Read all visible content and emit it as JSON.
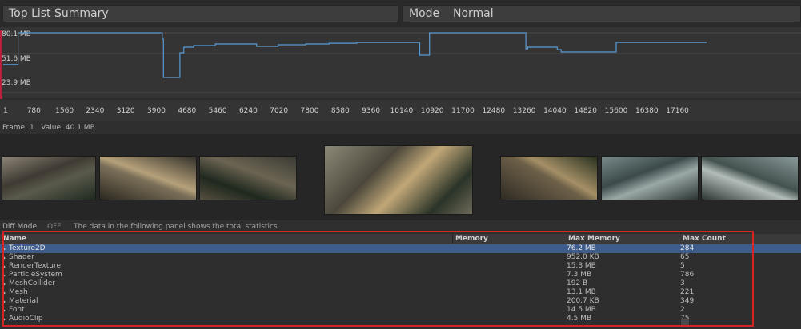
{
  "header": {
    "title": "Top List  Summary",
    "mode_label": "Mode",
    "mode_value": "Normal"
  },
  "chart_data": {
    "type": "line",
    "y_labels": [
      "80.1 MB",
      "51.6 MB",
      "23.9 MB"
    ],
    "x_ticks": [
      "1",
      "780",
      "1560",
      "2340",
      "3120",
      "3900",
      "4680",
      "5460",
      "6240",
      "7020",
      "7800",
      "8580",
      "9360",
      "10140",
      "10920",
      "11700",
      "12480",
      "13260",
      "14040",
      "14820",
      "15600",
      "16380",
      "17160"
    ],
    "series": [
      {
        "x": [
          1,
          380,
          4000,
          4050,
          4080,
          4420,
          4500,
          4600,
          4850,
          5400,
          6300,
          6450,
          7000,
          7700,
          8300,
          9000,
          9800,
          10500,
          10600,
          10700,
          10780,
          10850,
          11500,
          13200,
          13300,
          13350,
          14100,
          14200,
          15500,
          15600,
          17900
        ],
        "y": [
          40.1,
          80.1,
          80.1,
          72,
          23.9,
          23.9,
          55,
          62,
          64,
          66,
          66,
          63,
          65,
          66,
          67,
          68,
          68,
          68,
          52,
          52,
          52,
          80.1,
          80.1,
          80.1,
          60,
          62,
          59,
          56,
          56,
          68,
          68
        ]
      }
    ],
    "color": "#5a9bd5"
  },
  "frame_info": {
    "frame_label": "Frame:",
    "frame_value": "1",
    "value_label": "Value:",
    "value_value": "40.1 MB"
  },
  "diff": {
    "label": "Diff Mode",
    "state": "OFF",
    "note": "The data in the following panel shows the total statistics"
  },
  "table": {
    "columns": [
      "Name",
      "Memory",
      "Max Memory",
      "Max Count"
    ],
    "rows": [
      {
        "name": "Texture2D",
        "memory": "",
        "max_memory": "76.2 MB",
        "max_count": "284"
      },
      {
        "name": "Shader",
        "memory": "",
        "max_memory": "952.0 KB",
        "max_count": "65"
      },
      {
        "name": "RenderTexture",
        "memory": "",
        "max_memory": "15.8 MB",
        "max_count": "5"
      },
      {
        "name": "ParticleSystem",
        "memory": "",
        "max_memory": "7.3 MB",
        "max_count": "786"
      },
      {
        "name": "MeshCollider",
        "memory": "",
        "max_memory": "192 B",
        "max_count": "3"
      },
      {
        "name": "Mesh",
        "memory": "",
        "max_memory": "13.1 MB",
        "max_count": "221"
      },
      {
        "name": "Material",
        "memory": "",
        "max_memory": "200.7 KB",
        "max_count": "349"
      },
      {
        "name": "Font",
        "memory": "",
        "max_memory": "14.5 MB",
        "max_count": "2"
      },
      {
        "name": "AudioClip",
        "memory": "",
        "max_memory": "4.5 MB",
        "max_count": "75"
      }
    ]
  },
  "colors": {
    "selection": "#3e5d8c",
    "highlight_border": "#d62424",
    "line": "#5a9bd5"
  }
}
